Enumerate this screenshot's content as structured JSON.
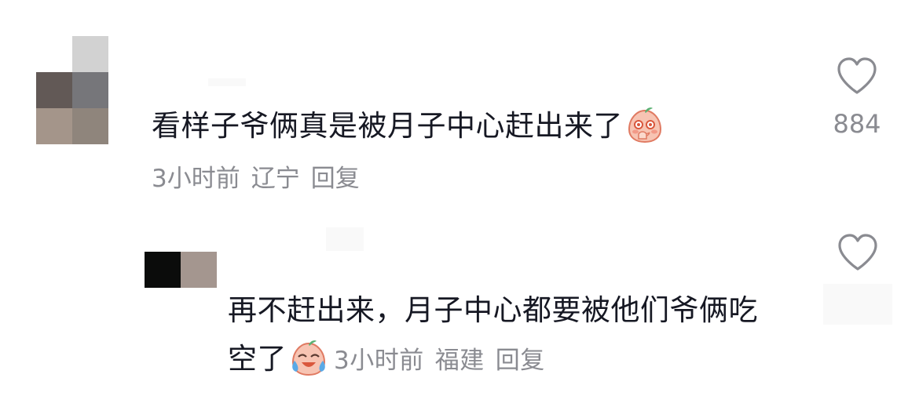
{
  "comments": [
    {
      "text": "看样子爷俩真是被月子中心赶出来了",
      "time": "3小时前",
      "location": "辽宁",
      "reply_label": "回复",
      "like_count": "884",
      "emoji": "covering-mouth-laugh-emoji"
    },
    {
      "text": "再不赶出来，月子中心都要被他们爷俩吃空了",
      "time": "3小时前",
      "location": "福建",
      "reply_label": "回复",
      "emoji": "tears-of-joy-emoji"
    }
  ],
  "colors": {
    "text": "#161823",
    "meta": "#8a8b91",
    "heart_stroke": "#8a8b91"
  }
}
